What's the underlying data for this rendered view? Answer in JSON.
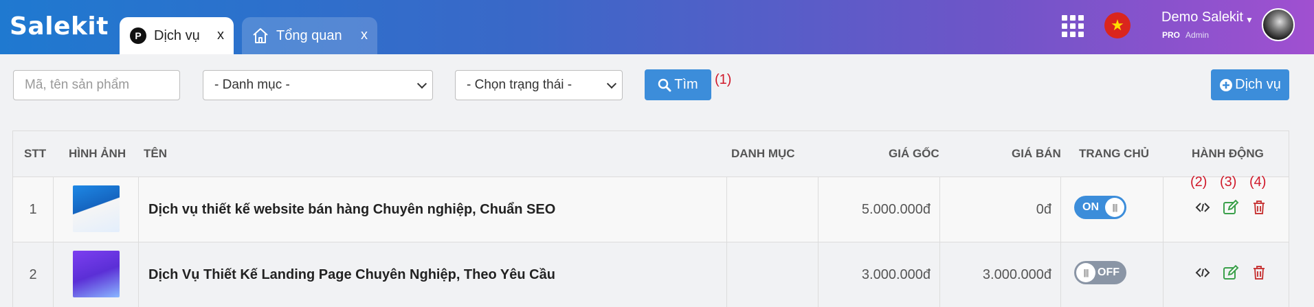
{
  "header": {
    "logo": "Salekit",
    "tabs": [
      {
        "label": "Dịch vụ",
        "icon": "p-circle-icon",
        "close": "x",
        "active": true
      },
      {
        "label": "Tổng quan",
        "icon": "home-icon",
        "close": "x",
        "active": false
      }
    ],
    "user": {
      "name": "Demo Salekit",
      "plan": "PRO",
      "role": "Admin"
    }
  },
  "filters": {
    "search_placeholder": "Mã, tên sản phẩm",
    "category_select": "- Danh mục -",
    "status_select": "- Chọn trạng thái -",
    "search_button": "Tìm",
    "add_button": "Dịch vụ"
  },
  "annotations": {
    "a1": "(1)",
    "a2": "(2)",
    "a3": "(3)",
    "a4": "(4)"
  },
  "table": {
    "columns": [
      "STT",
      "HÌNH ẢNH",
      "TÊN",
      "DANH MỤC",
      "GIÁ GỐC",
      "GIÁ BÁN",
      "TRANG CHỦ",
      "HÀNH ĐỘNG"
    ],
    "rows": [
      {
        "stt": "1",
        "name": "Dịch vụ thiết kế website bán hàng Chuyên nghiệp, Chuẩn SEO",
        "category": "",
        "original_price": "5.000.000đ",
        "sale_price": "0đ",
        "homepage": "ON"
      },
      {
        "stt": "2",
        "name": "Dịch Vụ Thiết Kế Landing Page Chuyên Nghiệp, Theo Yêu Cầu",
        "category": "",
        "original_price": "3.000.000đ",
        "sale_price": "3.000.000đ",
        "homepage": "OFF"
      }
    ]
  },
  "colors": {
    "primary": "#3c8dda",
    "edit": "#3aa04a",
    "delete": "#c83a3a",
    "annotation": "#d0192a"
  }
}
